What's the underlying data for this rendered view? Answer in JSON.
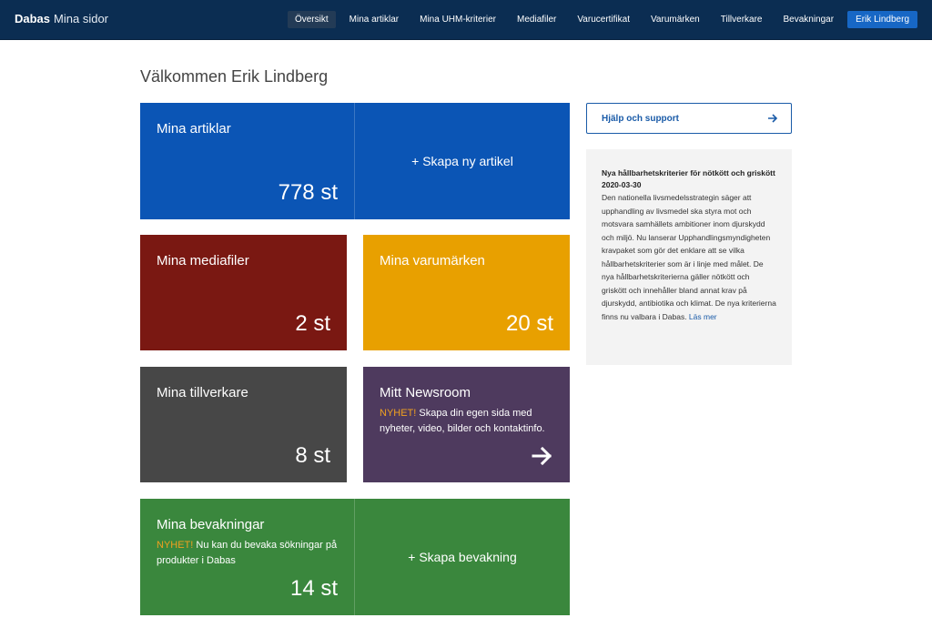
{
  "header": {
    "brand": "Dabas",
    "brand_sub": "Mina sidor",
    "nav": [
      "Översikt",
      "Mina artiklar",
      "Mina UHM-kriterier",
      "Mediafiler",
      "Varucertifikat",
      "Varumärken",
      "Tillverkare",
      "Bevakningar"
    ],
    "user": "Erik Lindberg"
  },
  "welcome": "Välkommen Erik Lindberg",
  "tiles": {
    "articles": {
      "title": "Mina artiklar",
      "count": "778 st",
      "action": "+ Skapa ny artikel"
    },
    "media": {
      "title": "Mina mediafiler",
      "count": "2 st"
    },
    "brands": {
      "title": "Mina varumärken",
      "count": "20 st"
    },
    "makers": {
      "title": "Mina tillverkare",
      "count": "8 st"
    },
    "newsroom": {
      "title": "Mitt Newsroom",
      "badge": "NYHET!",
      "text": " Skapa din egen sida med nyheter, video, bilder och kontaktinfo."
    },
    "watch": {
      "title": "Mina bevakningar",
      "badge": "NYHET!",
      "text": " Nu kan du bevaka sökningar på produkter i Dabas",
      "count": "14 st",
      "action": "+ Skapa bevakning"
    }
  },
  "help": {
    "label": "Hjälp och support"
  },
  "news": {
    "title": "Nya hållbarhetskriterier för nötkött och griskött 2020-03-30",
    "body": "Den nationella livsmedelsstrategin säger att upphandling av livsmedel ska styra mot och motsvara samhällets ambitioner inom djurskydd och miljö. Nu lanserar Upphandlingsmyndigheten kravpaket som gör det enklare att se vilka hållbarhetskriterier som är i linje med målet. De nya hållbarhetskriterierna gäller nötkött och griskött och innehåller bland annat krav på djurskydd, antibiotika och klimat. De nya kriterierna finns nu valbara i Dabas. ",
    "link": "Läs mer"
  },
  "colors": {
    "header": "#0b2d52",
    "articles": "#0b55b5",
    "media": "#7a1812",
    "brands": "#e8a000",
    "makers": "#474747",
    "newsroom": "#4e3a5e",
    "watch": "#3a873d",
    "badge": "#f0a020",
    "link": "#1a5ba8"
  },
  "icons": {
    "newsroom_arrow": "arrow-right-icon",
    "help_arrow": "arrow-right-icon"
  }
}
